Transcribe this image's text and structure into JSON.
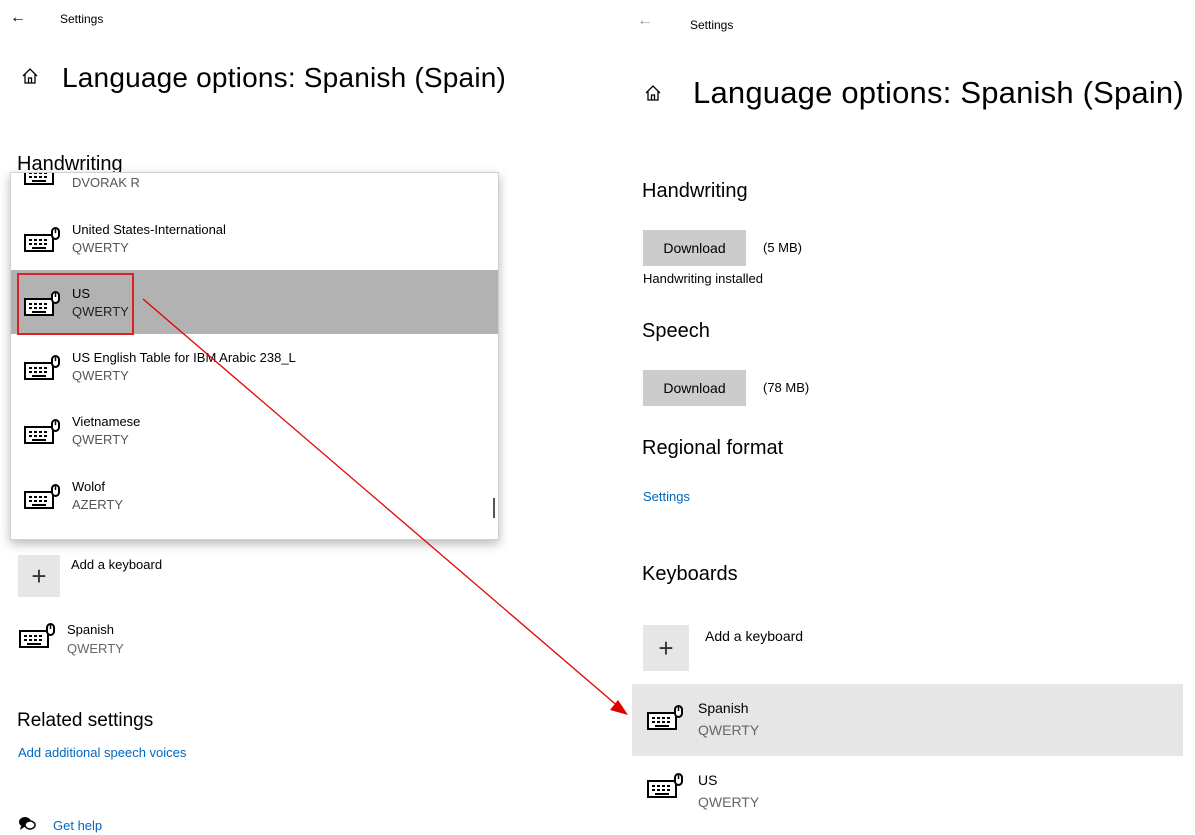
{
  "app_title": "Settings",
  "page_title": "Language options: Spanish (Spain)",
  "left": {
    "handwriting_heading": "Handwriting",
    "dropdown": {
      "items": [
        {
          "name": "",
          "layout": "DVORAK R"
        },
        {
          "name": "United States-International",
          "layout": "QWERTY"
        },
        {
          "name": "US",
          "layout": "QWERTY",
          "selected": true
        },
        {
          "name": "US English Table for IBM Arabic 238_L",
          "layout": "QWERTY"
        },
        {
          "name": "Vietnamese",
          "layout": "QWERTY"
        },
        {
          "name": "Wolof",
          "layout": "AZERTY"
        }
      ]
    },
    "add_keyboard_label": "Add a keyboard",
    "keyboards": [
      {
        "name": "Spanish",
        "layout": "QWERTY"
      }
    ],
    "related_settings_heading": "Related settings",
    "add_speech_voices_link": "Add additional speech voices",
    "get_help_link": "Get help"
  },
  "right": {
    "handwriting": {
      "heading": "Handwriting",
      "button": "Download",
      "size": "(5 MB)",
      "status": "Handwriting installed"
    },
    "speech": {
      "heading": "Speech",
      "button": "Download",
      "size": "(78 MB)"
    },
    "regional_format": {
      "heading": "Regional format",
      "link": "Settings"
    },
    "keyboards": {
      "heading": "Keyboards",
      "add_label": "Add a keyboard",
      "items": [
        {
          "name": "Spanish",
          "layout": "QWERTY",
          "highlighted": true
        },
        {
          "name": "US",
          "layout": "QWERTY"
        }
      ]
    }
  },
  "colors": {
    "link": "#0067c0",
    "selected_row": "#b2b2b2",
    "annotation": "#ff0000",
    "hover_row": "#e6e6e6"
  }
}
